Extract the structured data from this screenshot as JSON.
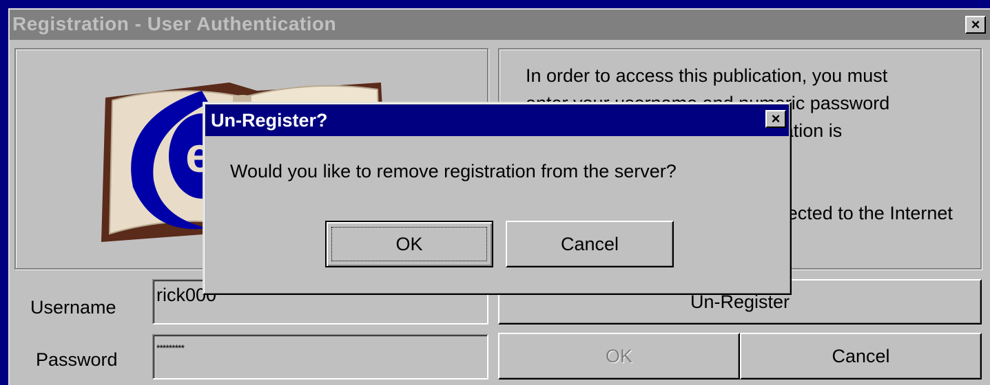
{
  "main_window": {
    "title": "Registration - User Authentication",
    "info_text": "In order to access this publication, you must\nenter your username and numeric password\nto authenticate. Once authentication is\nsuccessful, you may proceed.\n\nPlease make sure you are connected to the Internet to\nauthenticate this eBook.",
    "username_label": "Username",
    "username_value": "rick000",
    "password_label": "Password",
    "password_value": "*********",
    "unregister_label": "Un-Register",
    "ok_label": "OK",
    "cancel_label": "Cancel",
    "close_glyph": "×"
  },
  "dialog": {
    "title": "Un-Register?",
    "message": "Would you like to remove registration from the server?",
    "ok_label": "OK",
    "cancel_label": "Cancel",
    "close_glyph": "×"
  },
  "colors": {
    "desktop": "#000080",
    "face": "#c0c0c0",
    "active_title": "#000080",
    "inactive_title": "#808080",
    "logo_blue": "#0000a8"
  },
  "icons": [
    "close-icon",
    "ebook-logo-icon"
  ]
}
